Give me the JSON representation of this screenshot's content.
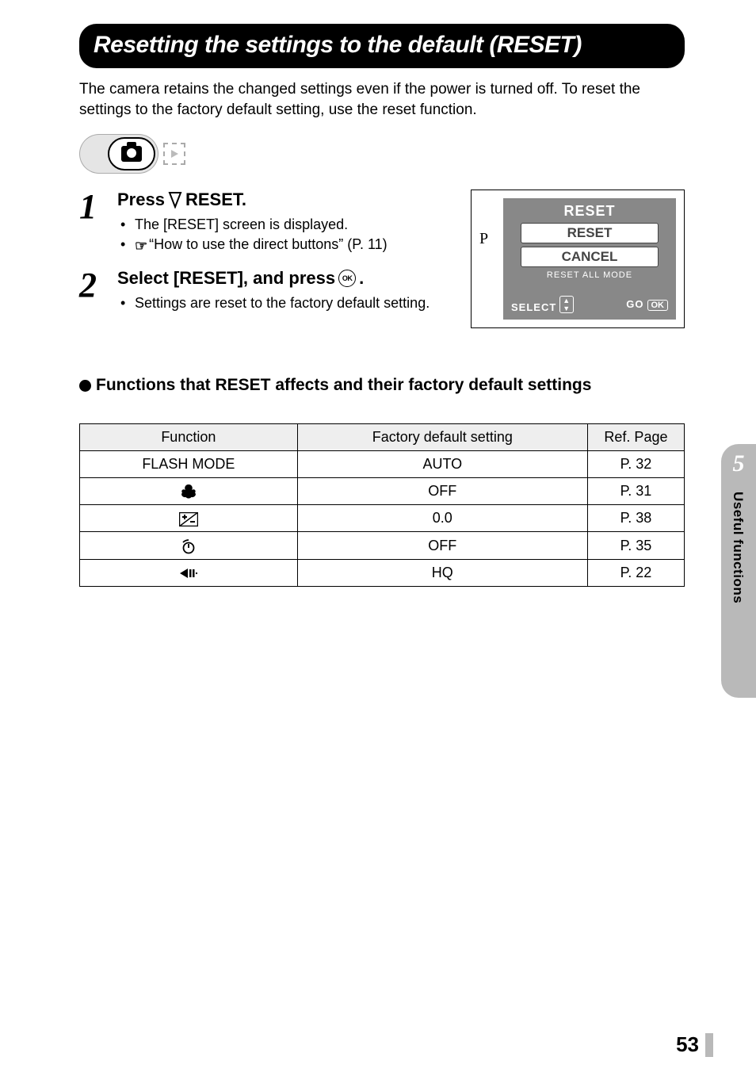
{
  "title": "Resetting the settings to the default (RESET)",
  "intro": "The camera retains the changed settings even if the power is turned off. To reset the settings to the factory default setting, use the reset function.",
  "steps": [
    {
      "num": "1",
      "title_pre": "Press ",
      "title_post": "RESET.",
      "bullets": [
        {
          "text": "The [RESET] screen is displayed."
        },
        {
          "text": "“How to use the direct buttons” (P. 11)",
          "hand": true
        }
      ]
    },
    {
      "num": "2",
      "title_pre": "Select [RESET], and press ",
      "title_post": ".",
      "bullets": [
        {
          "text": "Settings are reset to the factory default setting."
        }
      ]
    }
  ],
  "screen": {
    "mode": "P",
    "title": "RESET",
    "opt1": "RESET",
    "opt2": "CANCEL",
    "sub": "RESET ALL MODE",
    "select_label": "SELECT",
    "go_label": "GO",
    "ok_label": "OK"
  },
  "section_heading": "Functions that RESET affects and their factory default settings",
  "table": {
    "headers": [
      "Function",
      "Factory default setting",
      "Ref. Page"
    ],
    "rows": [
      {
        "fn_text": "FLASH MODE",
        "fn_icon": null,
        "default": "AUTO",
        "ref": "P. 32"
      },
      {
        "fn_text": null,
        "fn_icon": "macro",
        "default": "OFF",
        "ref": "P. 31"
      },
      {
        "fn_text": null,
        "fn_icon": "expcomp",
        "default": "0.0",
        "ref": "P. 38"
      },
      {
        "fn_text": null,
        "fn_icon": "selftimer",
        "default": "OFF",
        "ref": "P. 35"
      },
      {
        "fn_text": null,
        "fn_icon": "quality",
        "default": "HQ",
        "ref": "P. 22"
      }
    ]
  },
  "side_tab": {
    "num": "5",
    "label": "Useful functions"
  },
  "page_number": "53"
}
